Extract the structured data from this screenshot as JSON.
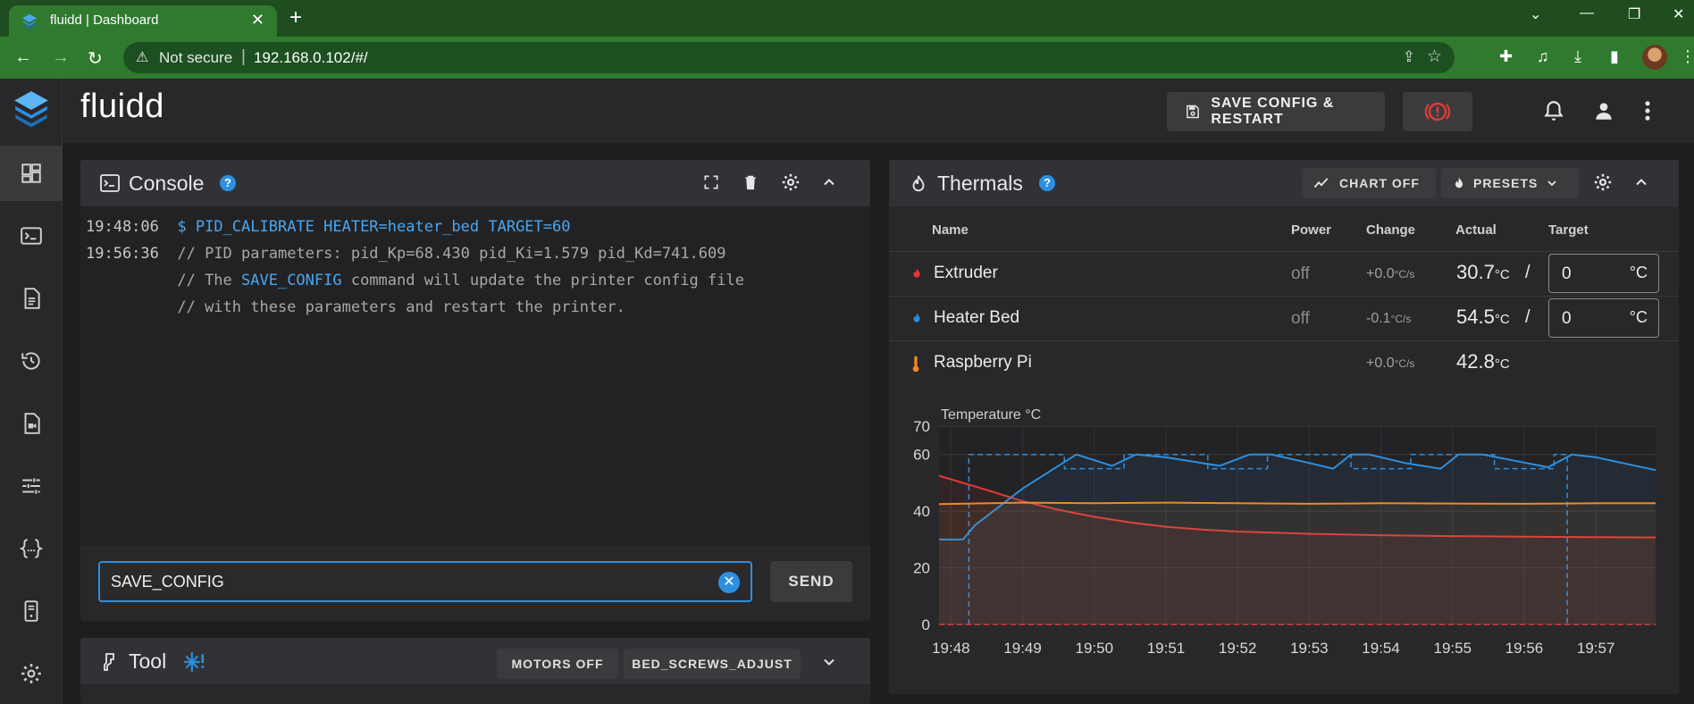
{
  "browser": {
    "tab_title": "fluidd | Dashboard",
    "security_label": "Not secure",
    "url": "192.168.0.102/#/"
  },
  "app": {
    "brand": "fluidd",
    "save_config_label": "SAVE CONFIG & RESTART"
  },
  "console": {
    "title": "Console",
    "lines": [
      {
        "time": "19:48:06",
        "text": "$ PID_CALIBRATE HEATER=heater_bed TARGET=60"
      },
      {
        "time": "19:56:36",
        "text": "// PID parameters: pid_Kp=68.430 pid_Ki=1.579 pid_Kd=741.609"
      },
      {
        "pre": "// The ",
        "hl": "SAVE_CONFIG",
        "post": " command will update the printer config file"
      },
      {
        "text": "// with these parameters and restart the printer."
      }
    ],
    "input_value": "SAVE_CONFIG",
    "send_label": "SEND"
  },
  "tool": {
    "title": "Tool",
    "motors_off_label": "MOTORS OFF",
    "bed_screws_label": "BED_SCREWS_ADJUST"
  },
  "thermals": {
    "title": "Thermals",
    "chart_toggle_label": "CHART OFF",
    "presets_label": "PRESETS",
    "columns": [
      "Name",
      "Power",
      "Change",
      "Actual",
      "Target"
    ],
    "rows": [
      {
        "name": "Extruder",
        "power": "off",
        "change": "+0.0",
        "change_unit": "°C/s",
        "actual": "30.7",
        "actual_unit": "°C",
        "slash": "/",
        "target": "0",
        "target_unit": "°C",
        "color": "#e53935"
      },
      {
        "name": "Heater Bed",
        "power": "off",
        "change": "-0.1",
        "change_unit": "°C/s",
        "actual": "54.5",
        "actual_unit": "°C",
        "slash": "/",
        "target": "0",
        "target_unit": "°C",
        "color": "#2d8fe0"
      },
      {
        "name": "Raspberry Pi",
        "power": "",
        "change": "+0.0",
        "change_unit": "°C/s",
        "actual": "42.8",
        "actual_unit": "°C",
        "color": "#f0891e"
      }
    ]
  },
  "chart_data": {
    "type": "line",
    "title": "Temperature °C",
    "x_ticks": [
      "19:48",
      "19:49",
      "19:50",
      "19:51",
      "19:52",
      "19:53",
      "19:54",
      "19:55",
      "19:56",
      "19:57"
    ],
    "xlim": [
      "19:47:50",
      "19:57:50"
    ],
    "ylim": [
      0,
      70
    ],
    "y_ticks": [
      0,
      20,
      40,
      60,
      70
    ],
    "grid": true,
    "series": [
      {
        "color": "#e53935",
        "x": [
          "19:47:50",
          "19:48:30",
          "19:49:00",
          "19:49:30",
          "19:50:00",
          "19:50:30",
          "19:51:00",
          "19:51:30",
          "19:52:00",
          "19:53:00",
          "19:54:00",
          "19:55:00",
          "19:56:00",
          "19:57:00",
          "19:57:50"
        ],
        "y": [
          52.5,
          47.5,
          43.5,
          40.5,
          38,
          36,
          34.5,
          33.5,
          32.8,
          32,
          31.5,
          31.2,
          31,
          30.8,
          30.7
        ]
      },
      {
        "color": "#2d8fe0",
        "x": [
          "19:47:50",
          "19:48:10",
          "19:48:20",
          "19:49:00",
          "19:49:45",
          "19:50:15",
          "19:50:35",
          "19:51:00",
          "19:51:45",
          "19:52:10",
          "19:52:28",
          "19:53:00",
          "19:53:20",
          "19:53:35",
          "19:53:50",
          "19:54:20",
          "19:54:50",
          "19:55:05",
          "19:55:25",
          "19:56:20",
          "19:56:40",
          "19:57:00",
          "19:57:50"
        ],
        "y": [
          30,
          30,
          35,
          48,
          60,
          56,
          60,
          59,
          56,
          60,
          60,
          57,
          55,
          60,
          60,
          57,
          55,
          60,
          60,
          55.5,
          60,
          59,
          54.5
        ]
      },
      {
        "color": "#2d8fe0",
        "dashed": true,
        "x": [
          "19:48:15",
          "19:48:15",
          "19:49:35",
          "19:49:35",
          "19:50:25",
          "19:50:25",
          "19:51:35",
          "19:51:35",
          "19:52:25",
          "19:52:25",
          "19:53:35",
          "19:53:35",
          "19:54:25",
          "19:54:25",
          "19:55:35",
          "19:55:35",
          "19:56:25",
          "19:56:25",
          "19:56:36",
          "19:56:36"
        ],
        "y": [
          0,
          60,
          60,
          55,
          55,
          60,
          60,
          55,
          55,
          60,
          60,
          55,
          55,
          60,
          60,
          55,
          55,
          60,
          60,
          0
        ]
      },
      {
        "color": "#f0891e",
        "x": [
          "19:47:50",
          "19:49:00",
          "19:50:00",
          "19:51:00",
          "19:52:00",
          "19:53:00",
          "19:54:00",
          "19:55:00",
          "19:56:00",
          "19:57:00",
          "19:57:50"
        ],
        "y": [
          42.5,
          43,
          42.8,
          43,
          42.8,
          42.6,
          42.8,
          42.7,
          42.6,
          42.8,
          42.8
        ]
      },
      {
        "color": "#e53935",
        "dashed": true,
        "x": [
          "19:47:50",
          "19:57:50"
        ],
        "y": [
          0,
          0
        ]
      }
    ]
  }
}
